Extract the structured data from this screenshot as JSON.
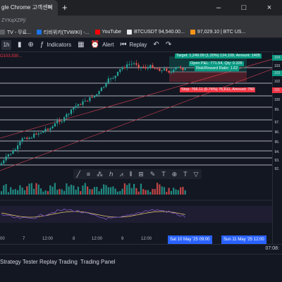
{
  "browser": {
    "tab_title": "gle Chrome 고객센터",
    "tab_close": "×",
    "new_tab": "+",
    "window_controls": [
      "–",
      "□",
      "×"
    ],
    "address": "ZYKqXZPj/",
    "bookmarks": [
      {
        "label": "TV - 무료...",
        "color": "#5f6368"
      },
      {
        "label": "티비위키(TVWIKI) -...",
        "color": "#1a73e8"
      },
      {
        "label": "YouTube",
        "color": "#ff0000"
      },
      {
        "label": "BTCUSDT 94,540.00...",
        "color": "#e8eaed"
      },
      {
        "label": "97,029.10 | BTC US...",
        "color": "#f7931a"
      }
    ]
  },
  "toolbar": {
    "timeframe": "1h",
    "indicators_label": "Indicators",
    "alert_label": "Alert",
    "replay_label": "Replay"
  },
  "chart": {
    "ohlc_fragment": "O103,930...",
    "position": {
      "target": "Target: 1,249.09 (1.20%) 124,109, Amount: 1405",
      "open_pl": "Open P&L: 771.54, Qty: 0.326",
      "risk_reward": "Risk/Reward Ratio: 1.62",
      "stop": "Stop: 766.11 (0.74%) 76,611, Amount: 750"
    },
    "price_labels": [
      "104",
      "103",
      "103",
      "102",
      "101",
      "100",
      "99.",
      "97.",
      "96.",
      "95.",
      "94.",
      "93.",
      "92."
    ],
    "drawing_tools": [
      "╱",
      "≡",
      "⁂",
      "ℎ",
      "⩘",
      "⫴",
      "⊞",
      "✎",
      "T",
      "⊕",
      "T",
      "▽"
    ],
    "date_axis": [
      "00",
      "7",
      "12:00",
      "8",
      "12:00",
      "9",
      "12:00"
    ],
    "date_highlight_1": "Sat 10 May '25   09:00",
    "date_highlight_2": "Sun 11 May '25   12:00",
    "time": "07:08:",
    "colors": {
      "up": "#26a69a",
      "down": "#ef5350",
      "target_box": "#089981",
      "stop_box": "#f23645",
      "rsi": "#7e57c2",
      "ma": "#e0c26a"
    }
  },
  "bottom_panel": {
    "tabs": [
      "Strategy Tester",
      "Replay Trading",
      "Trading Panel"
    ]
  }
}
